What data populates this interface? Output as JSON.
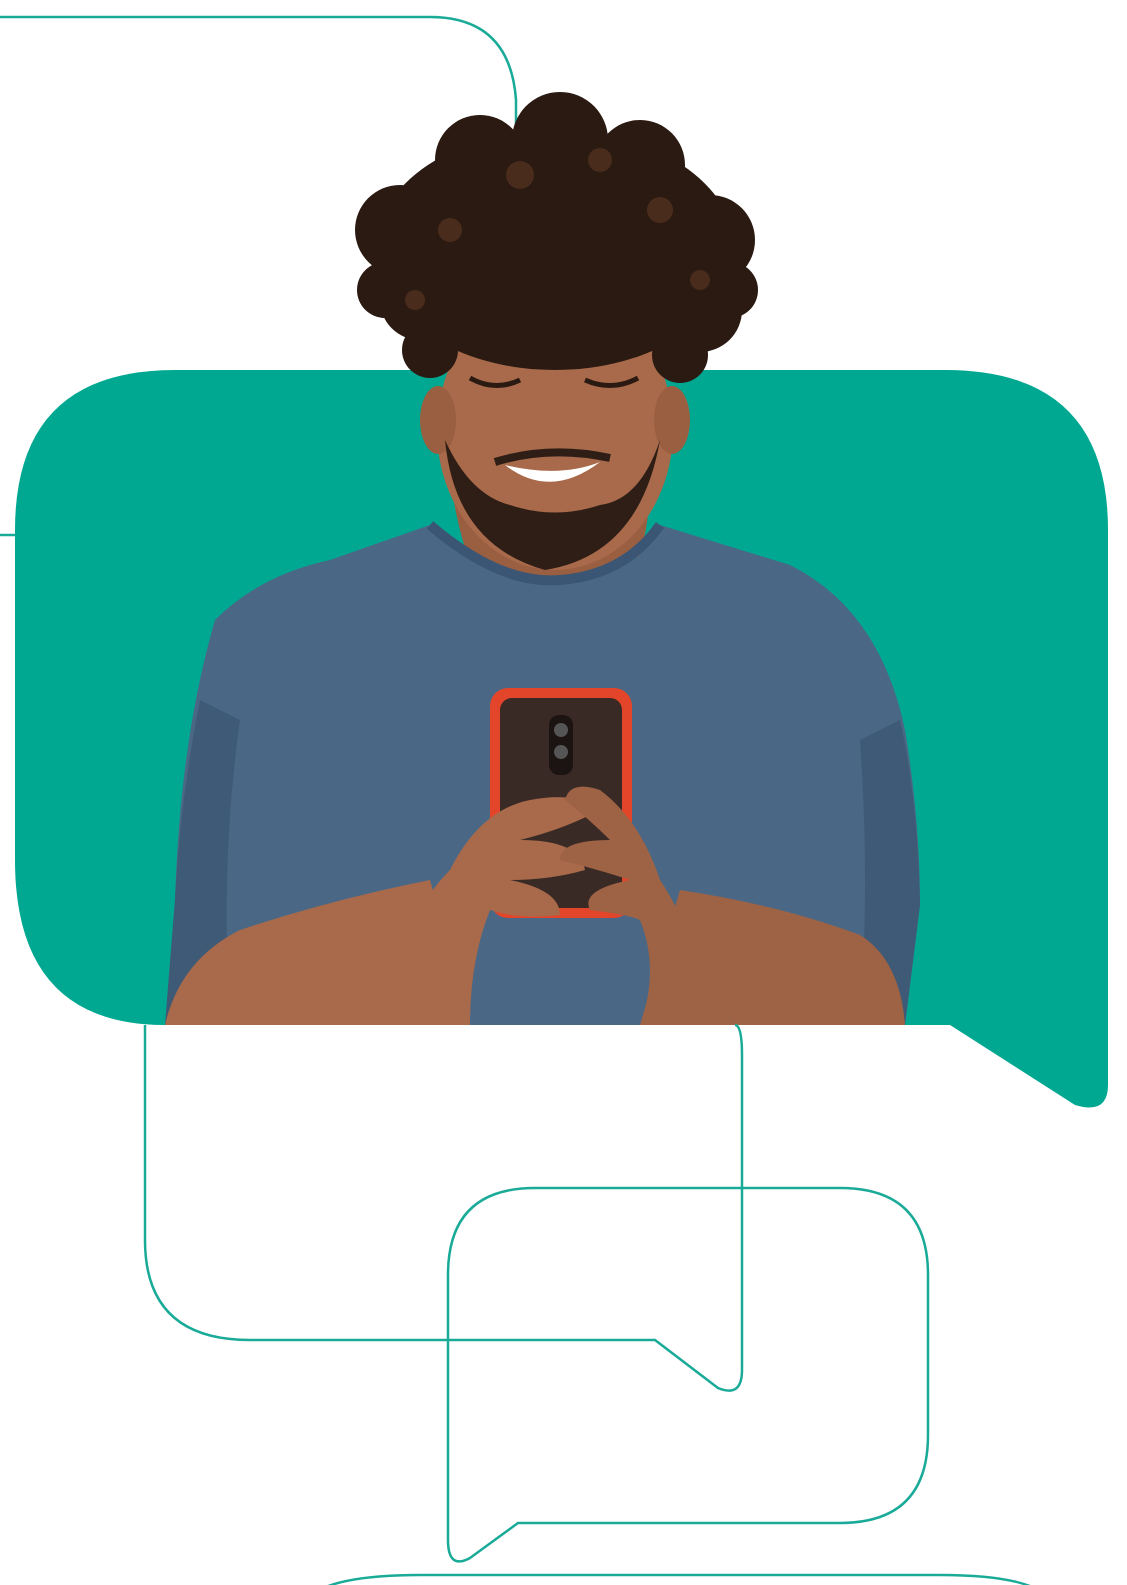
{
  "colors": {
    "accent": "#00a892",
    "outline": "#1aaa98",
    "background": "#ffffff",
    "shirt": "#4a6886",
    "skin": "#a86a4a",
    "hair": "#2a1a12",
    "phone_case": "#e2452a",
    "phone_back": "#3a2a26"
  },
  "illustration": {
    "subject": "person-smiling-at-phone",
    "shapes": [
      "filled-speech-bubble",
      "outline-speech-bubble",
      "outline-speech-bubble",
      "outline-speech-bubble"
    ]
  }
}
